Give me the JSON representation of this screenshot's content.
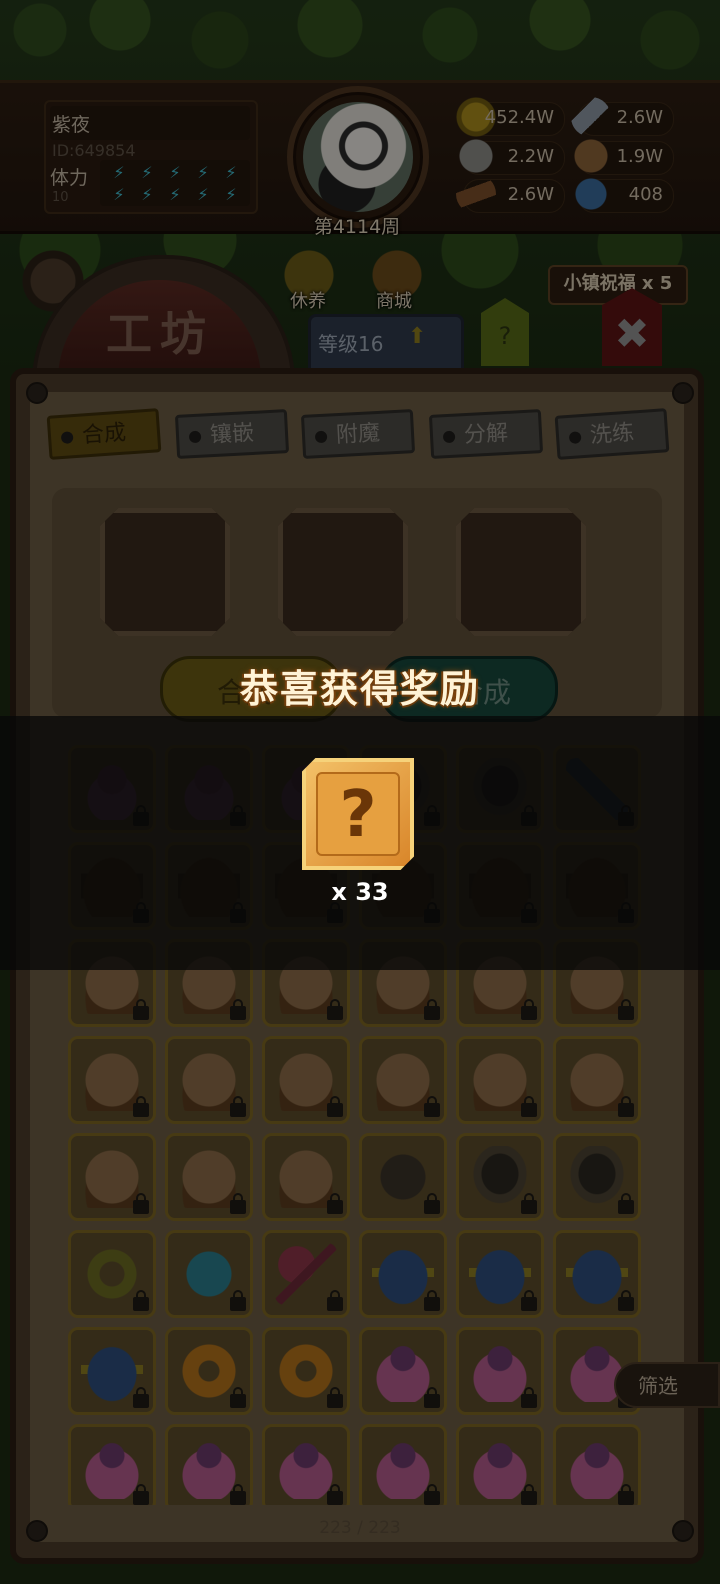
{
  "player": {
    "name": "紫夜",
    "id": "ID:649854",
    "stamina_label": "体力",
    "stamina_value": "10",
    "week": "第4114周"
  },
  "resources": [
    {
      "icon": "gold-coin-icon",
      "value": "452.4W"
    },
    {
      "icon": "iron-ingot-icon",
      "value": "2.6W"
    },
    {
      "icon": "stone-icon",
      "value": "2.2W"
    },
    {
      "icon": "leather-icon",
      "value": "1.9W"
    },
    {
      "icon": "wood-log-icon",
      "value": "2.6W"
    },
    {
      "icon": "crystal-icon",
      "value": "408"
    }
  ],
  "menu": {
    "rest_label": "休养",
    "shop_label": "商城",
    "blessing": "小镇祝福 x 5"
  },
  "workshop": {
    "title": "工坊",
    "level": "等级16",
    "help": "?",
    "close": "✖"
  },
  "tabs": [
    {
      "label": "合成",
      "active": true
    },
    {
      "label": "镶嵌",
      "active": false
    },
    {
      "label": "附魔",
      "active": false
    },
    {
      "label": "分解",
      "active": false
    },
    {
      "label": "洗练",
      "active": false
    }
  ],
  "actions": {
    "left_button": "合成",
    "right_button": "合成"
  },
  "inventory": {
    "rows": [
      [
        "bag",
        "bag",
        "bag",
        "armor",
        "armor",
        "claw"
      ],
      [
        "chest",
        "chest",
        "chest",
        "chest",
        "chest",
        "chest"
      ],
      [
        "chest-open",
        "chest-open",
        "chest-open",
        "chest-open",
        "chest-open",
        "chest-open"
      ],
      [
        "chest-open",
        "chest-open",
        "chest-open",
        "chest-open",
        "chest-open",
        "chest-open"
      ],
      [
        "chest-open",
        "chest-open",
        "chest-open",
        "shield",
        "armor",
        "armor"
      ],
      [
        "ring",
        "helm-cyan",
        "axe",
        "helm-blue",
        "helm-blue",
        "helm-blue"
      ],
      [
        "helm-blue",
        "dragon",
        "dragon",
        "bag-pink",
        "bag-pink",
        "bag-pink"
      ],
      [
        "bag-pink",
        "bag-pink",
        "bag-pink",
        "bag-pink",
        "bag-pink",
        "bag-pink"
      ]
    ],
    "filter_label": "筛选",
    "count": "223 / 223"
  },
  "reward": {
    "title": "恭喜获得奖励",
    "item_icon": "mystery-box-icon",
    "item_glyph": "?",
    "quantity": "x 33"
  }
}
